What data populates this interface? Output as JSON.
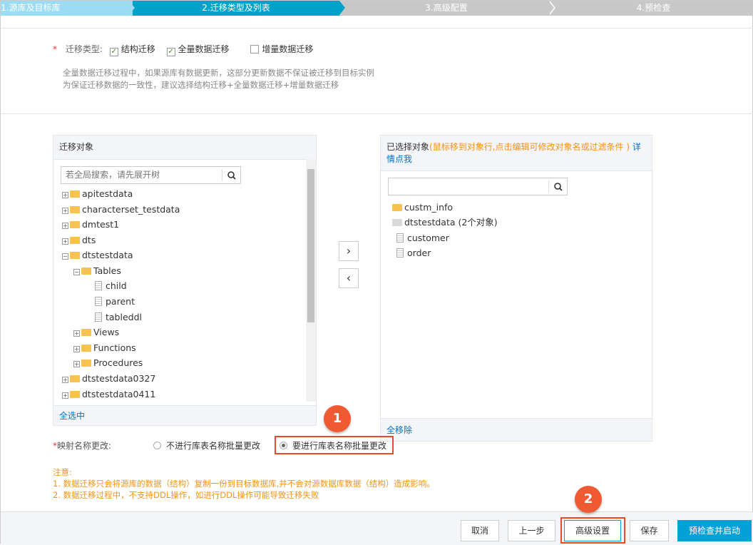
{
  "steps": [
    {
      "label": "1.源库及目标库",
      "state": "done"
    },
    {
      "label": "2.迁移类型及列表",
      "state": "active"
    },
    {
      "label": "3.高级配置",
      "state": "pending"
    },
    {
      "label": "4.预检查",
      "state": "pending"
    }
  ],
  "migration_type": {
    "label": "迁移类型:",
    "required": "*",
    "options": [
      {
        "label": "结构迁移",
        "checked": true
      },
      {
        "label": "全量数据迁移",
        "checked": true
      },
      {
        "label": "增量数据迁移",
        "checked": false
      }
    ],
    "hint": [
      "全量数据迁移过程中，如果源库有数据更新，这部分更新数据不保证被迁移到目标实例",
      "为保证迁移数据的一致性，建议选择结构迁移+全量数据迁移+增量数据迁移"
    ]
  },
  "left_panel": {
    "title": "迁移对象",
    "search_placeholder": "若全局搜索，请先展开树",
    "select_all": "全选中",
    "tree": [
      "apitestdata",
      "characterset_testdata",
      "dmtest1",
      "dts",
      "dtstestdata",
      "Tables",
      "child",
      "parent",
      "tableddl",
      "Views",
      "Functions",
      "Procedures",
      "dtstestdata0327",
      "dtstestdata0411"
    ]
  },
  "right_panel": {
    "title": "已选择对象",
    "hint": "(鼠标移到对象行,点击编辑可修改对象名或过滤条件 )",
    "link": "详情点我",
    "remove_all": "全移除",
    "items": [
      "custm_info",
      "dtstestdata (2个对象)",
      "customer",
      "order"
    ]
  },
  "transfer": {
    "right": "›",
    "left": "‹"
  },
  "mapping": {
    "label": "映射名称更改:",
    "required": "*",
    "options": [
      {
        "label": "不进行库表名称批量更改",
        "selected": false
      },
      {
        "label": "要进行库表名称批量更改",
        "selected": true
      }
    ]
  },
  "notes": {
    "title": "注意:",
    "lines": [
      "1. 数据迁移只会将源库的数据（结构）复制一份到目标数据库,并不会对源数据库数据（结构）造成影响。",
      "2. 数据迁移过程中，不支持DDL操作，如进行DDL操作可能导致迁移失败"
    ]
  },
  "buttons": {
    "cancel": "取消",
    "prev": "上一步",
    "advanced": "高级设置",
    "save": "保存",
    "precheck": "预检查并启动"
  },
  "callouts": [
    "1",
    "2"
  ],
  "colors": {
    "accent": "#00a2ca",
    "step_done": "#9bdcf3",
    "primary_button": "#00a1d6",
    "callout": "#ef5a33",
    "warning": "#f39317",
    "link": "#0073c6"
  }
}
